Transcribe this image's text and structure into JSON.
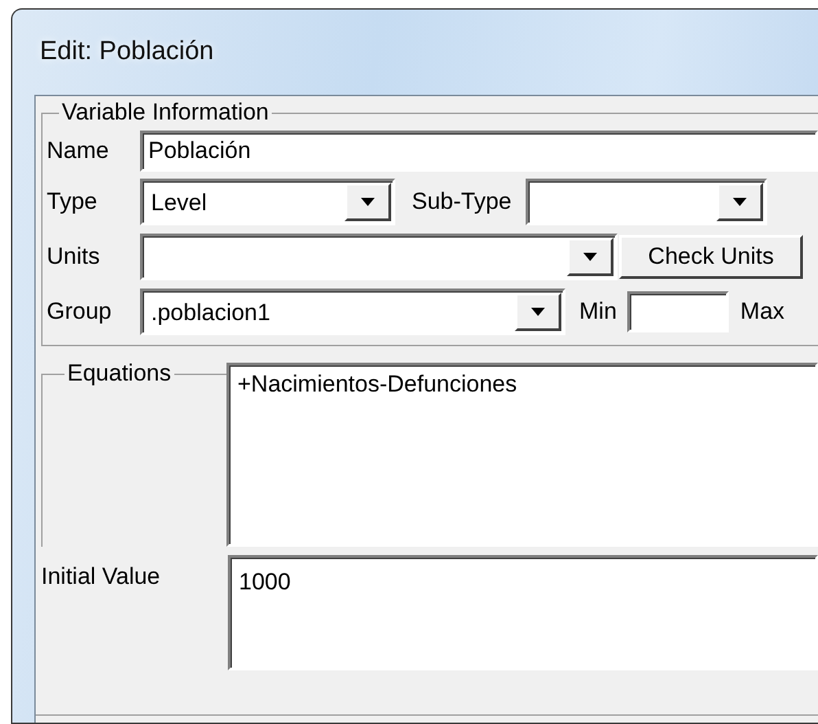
{
  "window": {
    "title": "Edit: Población"
  },
  "variable_information": {
    "legend": "Variable Information",
    "name": {
      "label": "Name",
      "value": "Población"
    },
    "type": {
      "label": "Type",
      "value": "Level"
    },
    "sub_type": {
      "label": "Sub-Type"
    },
    "units": {
      "label": "Units"
    },
    "check_units_button": "Check Units",
    "group": {
      "label": "Group",
      "value": ".poblacion1"
    },
    "min": {
      "label": "Min"
    },
    "max": {
      "label": "Max"
    }
  },
  "equations": {
    "legend": "Equations",
    "value": "+Nacimientos-Defunciones"
  },
  "initial_value": {
    "label": "Initial Value",
    "value": "1000"
  }
}
